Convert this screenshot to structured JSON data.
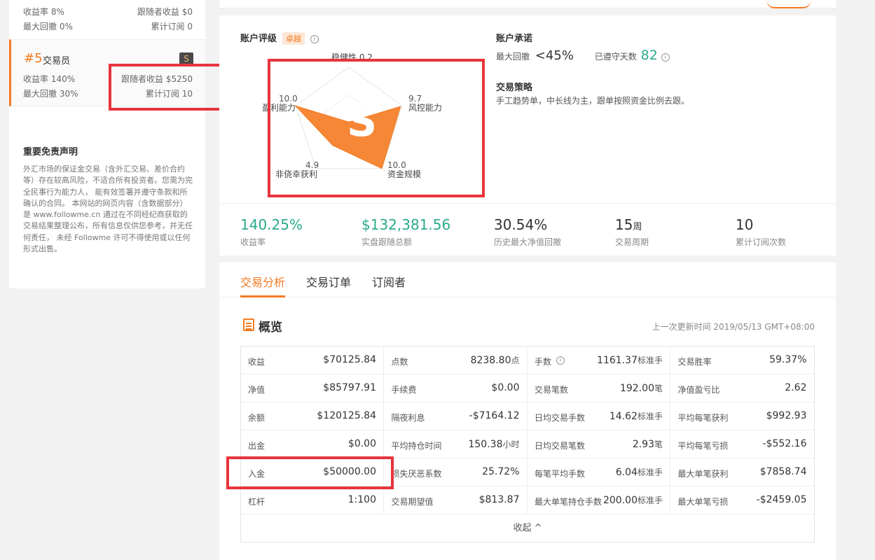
{
  "sidebar": {
    "trader_prev": {
      "return_label": "收益率 8%",
      "follower_label": "跟随者收益 $0",
      "drawdown_label": "最大回撤 0%",
      "subs_label": "累计订阅 0"
    },
    "trader5": {
      "rank": "#5",
      "role": "交易员",
      "badge": "S",
      "return_label": "收益率 140%",
      "follower_label": "跟随者收益 $5250",
      "drawdown_label": "最大回撤 30%",
      "subs_label": "累计订阅 10"
    },
    "disclaimer_title": "重要免责声明",
    "disclaimer_text": "外汇市场的保证金交易（含外汇交易、差价合约等）存在较高风险，不适合所有投资者。您需为完全民事行为能力人， 能有效签署并遵守条款和所确认的合同。 本网站的网页内容（含数据部分）是 www.followme.cn 通过在不同经纪商获取的交易结果整理公布，所有信息仅供您参考，并无任何责任， 未经 Followme 许可不得使用或以任何形式出售。"
  },
  "rating": {
    "label": "账户评级",
    "badge": "卓越",
    "grade": "S",
    "axes": [
      {
        "name": "稳健性",
        "value": 0.2
      },
      {
        "name": "风控能力",
        "value": 9.7
      },
      {
        "name": "资金规模",
        "value": 10.0
      },
      {
        "name": "非侥幸获利",
        "value": 4.9
      },
      {
        "name": "盈利能力",
        "value": 10.0
      }
    ],
    "axis_text": {
      "stability": "稳健性 0.2",
      "risk_val": "9.7",
      "risk_name": "风控能力",
      "scale_val": "10.0",
      "scale_name": "资金规模",
      "luck_val": "4.9",
      "luck_name": "非侥幸获利",
      "profit_val": "10.0",
      "profit_name": "盈利能力"
    }
  },
  "commitment": {
    "label": "账户承诺",
    "max_dd_label": "最大回撤",
    "max_dd_value": "<45%",
    "days_label": "已遵守天数",
    "days_value": "82"
  },
  "strategy": {
    "label": "交易策略",
    "text": "手工趋势单，中长线为主，跟单按照资金比例去跟。"
  },
  "stats": [
    {
      "value": "140.25%",
      "label": "收益率"
    },
    {
      "value": "$132,381.56",
      "label": "实盘跟随总额"
    },
    {
      "value": "30.54%",
      "label": "历史最大净值回撤"
    },
    {
      "value": "15",
      "unit": "周",
      "label": "交易周期"
    },
    {
      "value": "10",
      "label": "累计订阅次数"
    }
  ],
  "tabs": [
    "交易分析",
    "交易订单",
    "订阅者"
  ],
  "overview": {
    "title": "概览",
    "updated": "上一次更新时间 2019/05/13 GMT+08:00",
    "collapse": "收起 ^",
    "rows": [
      [
        [
          "收益",
          "$70125.84",
          ""
        ],
        [
          "点数",
          "8238.80",
          "点"
        ],
        [
          "手数",
          "1161.37",
          "标准手"
        ],
        [
          "交易胜率",
          "59.37%",
          ""
        ]
      ],
      [
        [
          "净值",
          "$85797.91",
          ""
        ],
        [
          "手续费",
          "$0.00",
          ""
        ],
        [
          "交易笔数",
          "192.00",
          "笔"
        ],
        [
          "净值盈亏比",
          "2.62",
          ""
        ]
      ],
      [
        [
          "余额",
          "$120125.84",
          ""
        ],
        [
          "隔夜利息",
          "-$7164.12",
          ""
        ],
        [
          "日均交易手数",
          "14.62",
          "标准手"
        ],
        [
          "平均每笔获利",
          "$992.93",
          ""
        ]
      ],
      [
        [
          "出金",
          "$0.00",
          ""
        ],
        [
          "平均持仓时间",
          "150.38",
          "小时"
        ],
        [
          "日均交易笔数",
          "2.93",
          "笔"
        ],
        [
          "平均每笔亏损",
          "-$552.16",
          ""
        ]
      ],
      [
        [
          "入金",
          "$50000.00",
          ""
        ],
        [
          "损失厌恶系数",
          "25.72%",
          ""
        ],
        [
          "每笔平均手数",
          "6.04",
          "标准手"
        ],
        [
          "最大单笔获利",
          "$7858.74",
          ""
        ]
      ],
      [
        [
          "杠杆",
          "1:100",
          ""
        ],
        [
          "交易期望值",
          "$813.87",
          ""
        ],
        [
          "最大单笔持仓手数",
          "200.00",
          "标准手"
        ],
        [
          "最大单笔亏损",
          "-$2459.05",
          ""
        ]
      ]
    ]
  },
  "colors": {
    "accent": "#f47a20",
    "green": "#2aaa8a",
    "highlight": "#e8343c"
  }
}
